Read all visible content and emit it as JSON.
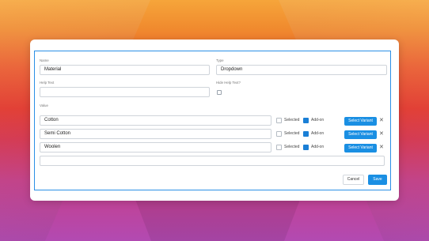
{
  "form": {
    "name_label": "Name",
    "name_value": "Material",
    "type_label": "Type",
    "type_value": "Dropdown",
    "help_label": "Help Text",
    "help_value": "",
    "hide_help_label": "Hide Help Text?",
    "value_label": "Value"
  },
  "values": [
    {
      "text": "Cotton",
      "selected_label": "Selected",
      "addon_label": "Add-on",
      "variant_label": "Select Variant",
      "remove": "✕"
    },
    {
      "text": "Semi Cotton",
      "selected_label": "Selected",
      "addon_label": "Add-on",
      "variant_label": "Select Variant",
      "remove": "✕"
    },
    {
      "text": "Woolen",
      "selected_label": "Selected",
      "addon_label": "Add-on",
      "variant_label": "Select Variant",
      "remove": "✕"
    }
  ],
  "new_value": "",
  "actions": {
    "cancel": "Cancel",
    "save": "Save"
  },
  "colors": {
    "accent": "#1a8fe3",
    "panel_border": "#2b8fe6"
  }
}
